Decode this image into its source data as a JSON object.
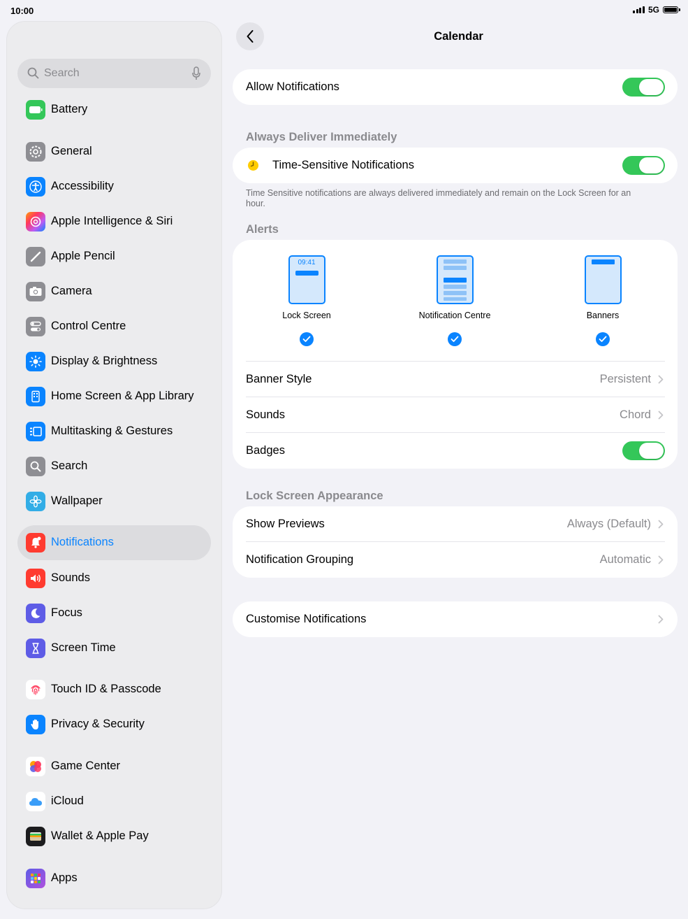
{
  "status_bar": {
    "time": "10:00",
    "network": "5G"
  },
  "sidebar": {
    "search_placeholder": "Search",
    "items": [
      {
        "label": "Battery",
        "icon": "battery-icon",
        "color": "#34c759"
      },
      {
        "label": "General",
        "icon": "gear-icon",
        "color": "#8e8e93"
      },
      {
        "label": "Accessibility",
        "icon": "accessibility-icon",
        "color": "#0a84ff"
      },
      {
        "label": "Apple Intelligence & Siri",
        "icon": "siri-icon",
        "color": "#ff6b6b"
      },
      {
        "label": "Apple Pencil",
        "icon": "pencil-icon",
        "color": "#8e8e93"
      },
      {
        "label": "Camera",
        "icon": "camera-icon",
        "color": "#8e8e93"
      },
      {
        "label": "Control Centre",
        "icon": "control-centre-icon",
        "color": "#8e8e93"
      },
      {
        "label": "Display & Brightness",
        "icon": "sun-icon",
        "color": "#0a84ff"
      },
      {
        "label": "Home Screen & App Library",
        "icon": "home-screen-icon",
        "color": "#0a84ff"
      },
      {
        "label": "Multitasking & Gestures",
        "icon": "multitasking-icon",
        "color": "#0a84ff"
      },
      {
        "label": "Search",
        "icon": "search-icon",
        "color": "#8e8e93"
      },
      {
        "label": "Wallpaper",
        "icon": "flower-icon",
        "color": "#32ade6"
      },
      {
        "label": "Notifications",
        "icon": "bell-icon",
        "color": "#ff3b30",
        "selected": true
      },
      {
        "label": "Sounds",
        "icon": "speaker-icon",
        "color": "#ff3b30"
      },
      {
        "label": "Focus",
        "icon": "moon-icon",
        "color": "#5e5ce6"
      },
      {
        "label": "Screen Time",
        "icon": "hourglass-icon",
        "color": "#5e5ce6"
      },
      {
        "label": "Touch ID & Passcode",
        "icon": "fingerprint-icon",
        "color": "#ffffff"
      },
      {
        "label": "Privacy & Security",
        "icon": "hand-icon",
        "color": "#0a84ff"
      },
      {
        "label": "Game Center",
        "icon": "game-center-icon",
        "color": "#ffffff"
      },
      {
        "label": "iCloud",
        "icon": "cloud-icon",
        "color": "#ffffff"
      },
      {
        "label": "Wallet & Apple Pay",
        "icon": "wallet-icon",
        "color": "#1c1c1e"
      },
      {
        "label": "Apps",
        "icon": "apps-grid-icon",
        "color": "#5e5ce6"
      }
    ]
  },
  "detail": {
    "title": "Calendar",
    "allow_notifications": {
      "label": "Allow Notifications",
      "on": true
    },
    "deliver_header": "Always Deliver Immediately",
    "time_sensitive": {
      "label": "Time-Sensitive Notifications",
      "on": true
    },
    "time_sensitive_note": "Time Sensitive notifications are always delivered immediately and remain on the Lock Screen for an hour.",
    "alerts_header": "Alerts",
    "alert_options": [
      {
        "label": "Lock Screen",
        "checked": true,
        "clock": "09:41"
      },
      {
        "label": "Notification Centre",
        "checked": true
      },
      {
        "label": "Banners",
        "checked": true
      }
    ],
    "banner_style": {
      "label": "Banner Style",
      "value": "Persistent"
    },
    "sounds": {
      "label": "Sounds",
      "value": "Chord"
    },
    "badges": {
      "label": "Badges",
      "on": true
    },
    "lock_screen_header": "Lock Screen Appearance",
    "show_previews": {
      "label": "Show Previews",
      "value": "Always (Default)"
    },
    "grouping": {
      "label": "Notification Grouping",
      "value": "Automatic"
    },
    "customise": {
      "label": "Customise Notifications"
    }
  },
  "colors": {
    "accent": "#0a84ff",
    "toggle_on": "#34c759",
    "background": "#f2f2f7"
  }
}
